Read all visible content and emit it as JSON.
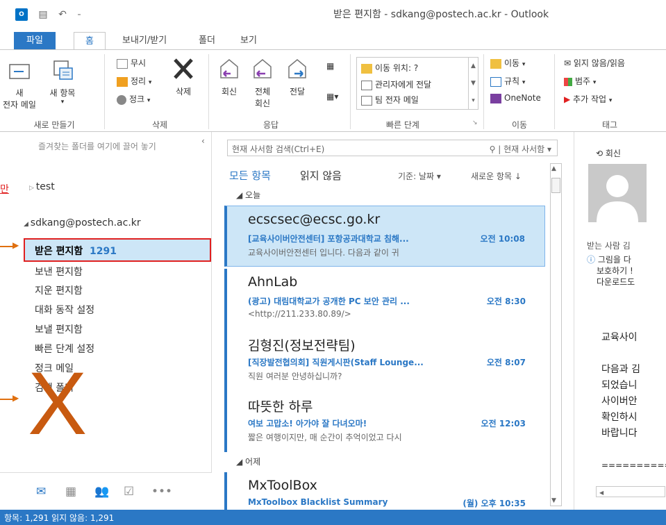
{
  "window": {
    "title": "받은 편지함 - sdkang@postech.ac.kr - Outlook",
    "app_icon": "O"
  },
  "ribbon_tabs": [
    "파일",
    "홈",
    "보내기/받기",
    "폴더",
    "보기"
  ],
  "ribbon": {
    "new_group": {
      "new_email_1": "새",
      "new_email_2": "전자 메일",
      "new_items": "새 항목",
      "group_label": "새로 만들기"
    },
    "delete_group": {
      "ignore": "무시",
      "cleanup": "정리",
      "junk": "정크",
      "delete": "삭제",
      "group_label": "삭제"
    },
    "respond_group": {
      "reply": "회신",
      "reply_all_1": "전체",
      "reply_all_2": "회신",
      "forward": "전달",
      "group_label": "응답"
    },
    "quick_steps": {
      "items": [
        "이동 위치: ?",
        "관리자에게 전달",
        "팀 전자 메일"
      ],
      "group_label": "빠른 단계"
    },
    "move_group": {
      "move": "이동",
      "rules": "규칙",
      "onenote": "OneNote",
      "group_label": "이동"
    },
    "tags_group": {
      "unread_read": "읽지 않음/읽음",
      "categorize": "범주",
      "followup": "추가 작업",
      "group_label": "태그"
    }
  },
  "folder_pane": {
    "favorites_hint": "즐겨찾는 폴더를 여기에 끌어 놓기",
    "test_folder": "test",
    "account": "sdkang@postech.ac.kr",
    "inbox_label": "받은 편지함",
    "inbox_count": "1291",
    "folders": [
      "보낸 편지함",
      "지운 편지함",
      "대화 동작 설정",
      "보낼 편지함",
      "빠른 단계 설정",
      "정크 메일",
      "검색 폴더"
    ],
    "annotation_mark": "X",
    "annotation_left": "만"
  },
  "search": {
    "placeholder": "현재 사서함 검색(Ctrl+E)",
    "scope": "현재 사서함"
  },
  "filters": {
    "all": "모든 항목",
    "unread": "읽지 않음",
    "sort_by": "기준: 날짜",
    "order": "새로운 항목 ↓"
  },
  "groups": {
    "today": "◢ 오늘",
    "yesterday": "◢ 어제"
  },
  "messages": [
    {
      "sender": "ecscsec@ecsc.go.kr",
      "subject": "[교육사이버안전센터] 포항공과대학교 침해...",
      "time": "오전 10:08",
      "preview": "교육사이버안전센터 입니다.  다음과 같이 귀"
    },
    {
      "sender": "AhnLab",
      "subject": "(광고) 대림대학교가 공개한 PC 보안 관리 ...",
      "time": "오전 8:30",
      "preview": "<http://211.233.80.89/>"
    },
    {
      "sender": "김형진(정보전략팀)",
      "subject": "[직장발전협의회] 직원게시판(Staff Lounge...",
      "time": "오전 8:07",
      "preview": "직원 여러분 안녕하십니까?"
    },
    {
      "sender": "따뜻한 하루",
      "subject": "여보 고맙소! 아가야 잘 다녀오마!",
      "time": "오전 12:03",
      "preview": "짧은 여행이지만, 매 순간이 추억이었고 다시"
    },
    {
      "sender": "MxToolBox",
      "subject": "MxToolbox Blacklist Summary",
      "time": "(월) 오후 10:35",
      "preview": ""
    }
  ],
  "reading_pane": {
    "reply": "회신",
    "to_label": "받는 사람  김",
    "info_line1": "그림을 다",
    "info_line2": "보호하기 !",
    "info_line3": "다운로드도",
    "body_lines": [
      "교육사이",
      "",
      "다음과 김",
      "되었습니",
      "사이버안",
      "확인하시",
      "바랍니다",
      "",
      "=========="
    ]
  },
  "status": {
    "text": "항목: 1,291    읽지 않음: 1,291"
  }
}
